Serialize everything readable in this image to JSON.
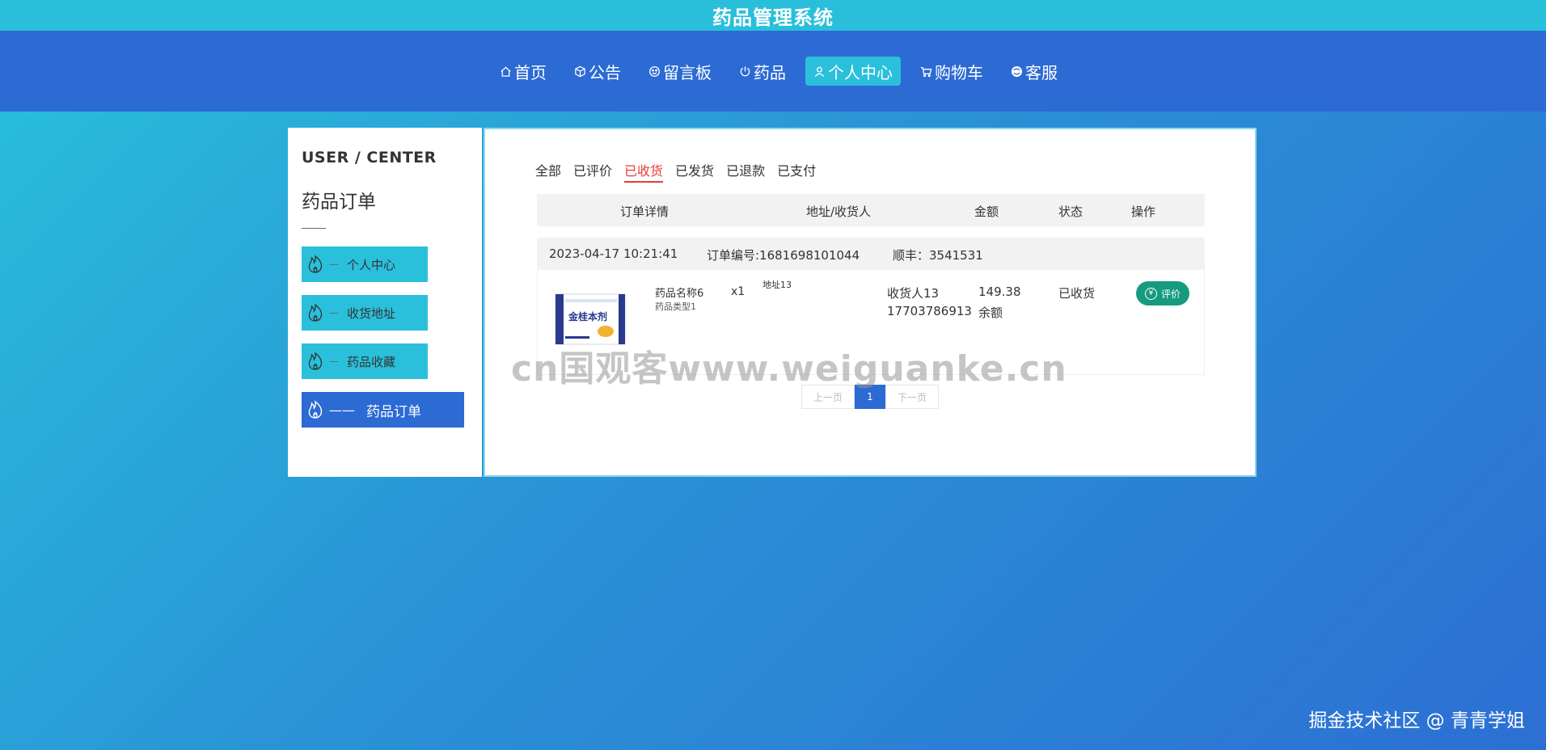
{
  "app": {
    "title": "药品管理系统"
  },
  "nav": {
    "items": [
      {
        "label": "首页",
        "icon": "home-icon"
      },
      {
        "label": "公告",
        "icon": "cube-icon"
      },
      {
        "label": "留言板",
        "icon": "face-icon"
      },
      {
        "label": "药品",
        "icon": "power-icon"
      },
      {
        "label": "个人中心",
        "icon": "user-icon",
        "active": true
      },
      {
        "label": "购物车",
        "icon": "cart-icon"
      },
      {
        "label": "客服",
        "icon": "chat-icon"
      }
    ]
  },
  "sidebar": {
    "heading": "USER / CENTER",
    "title": "药品订单",
    "items": [
      {
        "label": "个人中心",
        "dash": "—"
      },
      {
        "label": "收货地址",
        "dash": "—"
      },
      {
        "label": "药品收藏",
        "dash": "—"
      },
      {
        "label": "药品订单",
        "dash": "——",
        "active": true
      }
    ]
  },
  "tabs": [
    {
      "label": "全部"
    },
    {
      "label": "已评价"
    },
    {
      "label": "已收货",
      "active": true
    },
    {
      "label": "已发货"
    },
    {
      "label": "已退款"
    },
    {
      "label": "已支付"
    }
  ],
  "table": {
    "headers": {
      "detail": "订单详情",
      "address": "地址/收货人",
      "amount": "金额",
      "status": "状态",
      "action": "操作"
    }
  },
  "order": {
    "time": "2023-04-17 10:21:41",
    "number": "订单编号:1681698101044",
    "courier": "顺丰：3541531",
    "product_name": "药品名称6",
    "product_type": "药品类型1",
    "quantity": "x1",
    "address": "地址13",
    "receiver": "收货人13",
    "phone": "17703786913",
    "amount": "149.38",
    "payment": "余额",
    "status": "已收货",
    "action_label": "评价",
    "box_text": "金桂本剂"
  },
  "pager": {
    "prev": "上一页",
    "page": "1",
    "next": "下一页"
  },
  "overlay": {
    "watermark": "cn国观客www.weiguanke.cn",
    "credit": "掘金技术社区 @ 青青学姐"
  },
  "colors": {
    "title_bar": "#29bfdb",
    "nav_bar": "#2c6ad4",
    "accent_cyan": "#2ac0db",
    "active_tab": "#e53b3b",
    "eval_button": "#169b80"
  }
}
